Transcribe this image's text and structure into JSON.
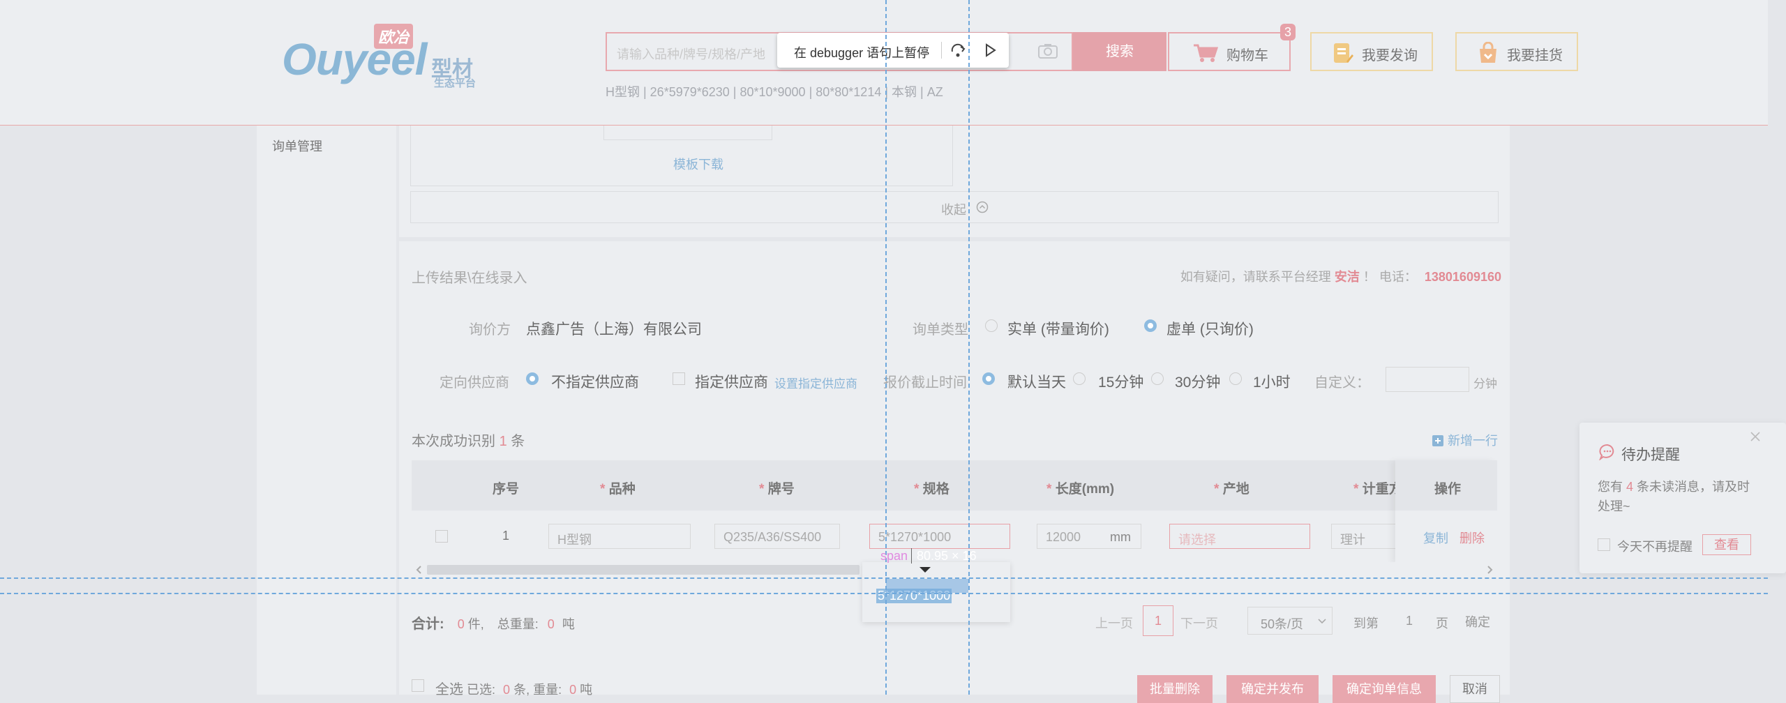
{
  "header": {
    "logo_text": "Ouyeel",
    "logo_badge": "欧冶",
    "logo_cn": "型材",
    "logo_sub": "生态平台",
    "search_placeholder": "请输入品种/牌号/规格/产地",
    "search_button": "搜索",
    "cart_label": "购物车",
    "cart_count": "3",
    "inquiry_button": "我要发询",
    "listing_button": "我要挂货",
    "hot_words": "H型钢 | 26*5979*6230 | 80*10*9000 | 80*80*1214 | 本钢 | AZ"
  },
  "debugger": {
    "message": "在 debugger 语句上暂停"
  },
  "sidebar": {
    "items": [
      {
        "label": "询单管理"
      }
    ]
  },
  "upload": {
    "template_link": "模板下载",
    "collapse_label": "收起"
  },
  "result": {
    "section_title": "上传结果\\在线录入",
    "contact_prefix": "如有疑问，请联系平台经理",
    "contact_name": "安洁",
    "contact_mid": "！ 电话：",
    "contact_phone": "13801609160",
    "inquirer_label": "询价方",
    "inquirer_value": "点鑫广告（上海）有限公司",
    "order_type_label": "询单类型",
    "order_type_options": [
      {
        "label": "实单 (带量询价)",
        "selected": false
      },
      {
        "label": "虚单 (只询价)",
        "selected": true
      }
    ],
    "supplier_label": "定向供应商",
    "supplier_options": [
      {
        "label": "不指定供应商",
        "selected": true
      },
      {
        "label": "指定供应商",
        "selected": false
      }
    ],
    "set_supplier_link": "设置指定供应商",
    "deadline_label": "报价截止时间",
    "deadline_options": [
      {
        "label": "默认当天",
        "selected": true
      },
      {
        "label": "15分钟",
        "selected": false
      },
      {
        "label": "30分钟",
        "selected": false
      },
      {
        "label": "1小时",
        "selected": false
      }
    ],
    "custom_label": "自定义：",
    "custom_unit": "分钟",
    "recognized_prefix": "本次成功识别",
    "recognized_count": "1",
    "recognized_suffix": "条",
    "add_row": "新增一行"
  },
  "table": {
    "columns": [
      "序号",
      "品种",
      "牌号",
      "规格",
      "长度(mm)",
      "产地",
      "计重方式",
      "操作"
    ],
    "required": [
      false,
      true,
      true,
      true,
      true,
      true,
      true,
      false
    ],
    "rows": [
      {
        "index": "1",
        "variety": "H型钢",
        "grade": "Q235/A36/SS400",
        "spec": "5*1270*1000",
        "length": "12000",
        "length_unit": "mm",
        "origin_placeholder": "请选择",
        "weight_method": "理计",
        "copy": "复制",
        "delete": "删除"
      }
    ],
    "dropdown_option": "5*1270*1000"
  },
  "inspector": {
    "tag": "span",
    "size": "80.95 × 16"
  },
  "summary": {
    "total_label": "合计:",
    "pieces": "0",
    "pieces_unit": "件,",
    "weight_label": "总重量:",
    "weight": "0",
    "weight_unit": "吨"
  },
  "pagination": {
    "prev": "上一页",
    "current": "1",
    "next": "下一页",
    "page_size": "50条/页",
    "goto_label": "到第",
    "goto_value": "1",
    "page_unit": "页",
    "confirm": "确定"
  },
  "footer": {
    "select_all": "全选",
    "selected_label": "已选:",
    "selected_count": "0",
    "selected_unit": "条, 重量:",
    "selected_weight": "0",
    "selected_weight_unit": "吨",
    "batch_delete": "批量删除",
    "confirm_publish": "确定并发布",
    "confirm_info": "确定询单信息",
    "cancel": "取消"
  },
  "reminder": {
    "title": "待办提醒",
    "msg_prefix": "您有",
    "msg_count": "4",
    "msg_suffix": "条未读消息，请及时处理~",
    "no_remind": "今天不再提醒",
    "view": "查看"
  },
  "colors": {
    "accent_red": "#e28a93",
    "accent_blue": "#8bb5d7",
    "guide_blue": "#6fa8dc"
  }
}
